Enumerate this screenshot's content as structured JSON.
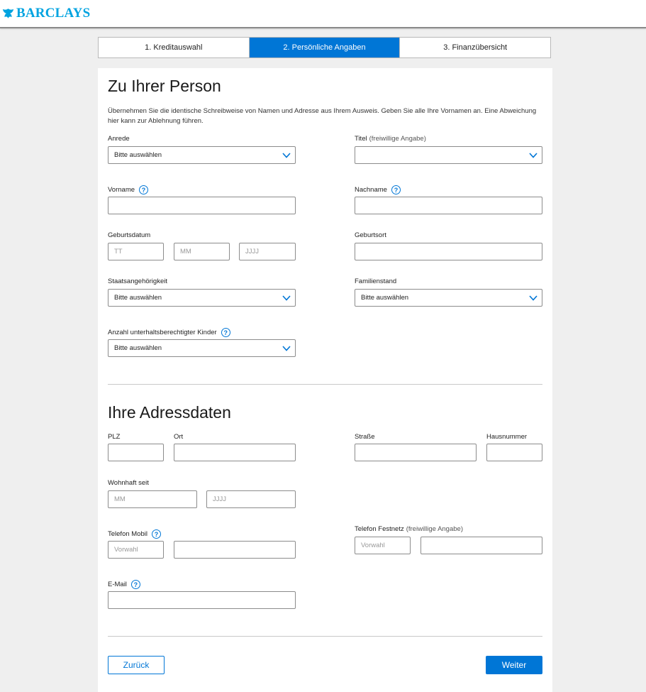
{
  "brand": {
    "name": "BARCLAYS",
    "color": "#00a3e0",
    "icon": "eagle-icon"
  },
  "steps": [
    {
      "label": "1. Kreditauswahl",
      "active": false
    },
    {
      "label": "2. Persönliche Angaben",
      "active": true
    },
    {
      "label": "3. Finanzübersicht",
      "active": false
    }
  ],
  "accent_color": "#0076d6",
  "person": {
    "title": "Zu Ihrer Person",
    "intro": "Übernehmen Sie die identische Schreibweise von Namen und Adresse aus Ihrem Ausweis. Geben Sie alle Ihre Vornamen an. Eine Abweichung hier kann zur Ablehnung führen.",
    "anrede": {
      "label": "Anrede",
      "value": "Bitte auswählen"
    },
    "titel": {
      "label": "Titel",
      "optional": "(freiwillige Angabe)",
      "value": ""
    },
    "vorname": {
      "label": "Vorname",
      "help": "?"
    },
    "nachname": {
      "label": "Nachname",
      "help": "?"
    },
    "geburtsdatum": {
      "label": "Geburtsdatum",
      "tt": "TT",
      "mm": "MM",
      "jjjj": "JJJJ"
    },
    "geburtsort": {
      "label": "Geburtsort"
    },
    "staatsangehoerigkeit": {
      "label": "Staatsangehörigkeit",
      "value": "Bitte auswählen"
    },
    "familienstand": {
      "label": "Familienstand",
      "value": "Bitte auswählen"
    },
    "kinder": {
      "label": "Anzahl unterhaltsberechtigter Kinder",
      "help": "?",
      "value": "Bitte auswählen"
    }
  },
  "address": {
    "title": "Ihre Adressdaten",
    "plz": {
      "label": "PLZ"
    },
    "ort": {
      "label": "Ort"
    },
    "strasse": {
      "label": "Straße"
    },
    "hausnummer": {
      "label": "Hausnummer"
    },
    "wohnhaft": {
      "label": "Wohnhaft seit",
      "mm": "MM",
      "jjjj": "JJJJ"
    },
    "mobil": {
      "label": "Telefon Mobil",
      "help": "?",
      "vorwahl": "Vorwahl"
    },
    "festnetz": {
      "label": "Telefon Festnetz",
      "optional": "(freiwillige Angabe)",
      "vorwahl": "Vorwahl"
    },
    "email": {
      "label": "E-Mail",
      "help": "?"
    }
  },
  "buttons": {
    "back": "Zurück",
    "next": "Weiter"
  }
}
